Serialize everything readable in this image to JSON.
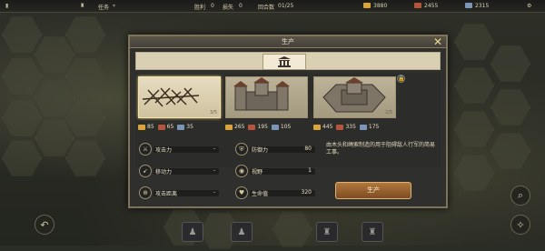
{
  "topbar": {
    "left_label": "任务",
    "stat1_label": "胜利",
    "stat1_value": "0",
    "stat2_label": "损失",
    "stat2_value": "0",
    "round_label": "回合数",
    "round_value": "01/25",
    "gold_value": "3880",
    "wood_value": "2455",
    "iron_value": "2315"
  },
  "modal": {
    "title": "生产",
    "close_label": "✕",
    "category_icon": "building-icon"
  },
  "units": [
    {
      "name": "barricade",
      "count": "3/5",
      "costs": [
        {
          "icon": "gold-icon",
          "value": "85"
        },
        {
          "icon": "wood-icon",
          "value": "65"
        },
        {
          "icon": "iron-icon",
          "value": "35"
        }
      ]
    },
    {
      "name": "fort",
      "count": "",
      "costs": [
        {
          "icon": "gold-icon",
          "value": "265"
        },
        {
          "icon": "wood-icon",
          "value": "195"
        },
        {
          "icon": "iron-icon",
          "value": "105"
        }
      ]
    },
    {
      "name": "fortress",
      "count": "2/5",
      "costs": [
        {
          "icon": "gold-icon",
          "value": "445"
        },
        {
          "icon": "wood-icon",
          "value": "335"
        },
        {
          "icon": "iron-icon",
          "value": "175"
        }
      ]
    }
  ],
  "stats": {
    "attack_label": "攻击力",
    "attack_value": "-",
    "defense_label": "防御力",
    "defense_value": "80",
    "mobility_label": "移动力",
    "mobility_value": "-",
    "vision_label": "视野",
    "vision_value": "1",
    "range_label": "攻击距离",
    "range_value": "-",
    "hp_label": "生命值",
    "hp_value": "320"
  },
  "description": "由木头和绳索制造的用于阻碍敌人行军的简易工事。",
  "produce_label": "生产",
  "colors": {
    "gold": "#d9a43a",
    "wood": "#b5543a",
    "iron": "#7b95b8",
    "button": "#9a6232"
  }
}
